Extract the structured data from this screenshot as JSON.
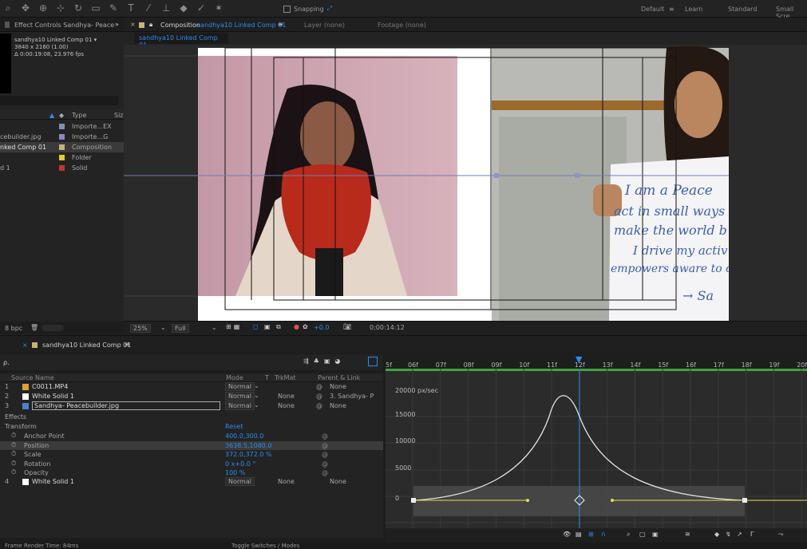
{
  "toolbar": {
    "snapping_label": "Snapping",
    "workspaces": [
      "Default",
      "Learn",
      "Standard",
      "Small Scre"
    ],
    "workspace_menu_icon": "menu-lines-icon"
  },
  "left_panel": {
    "tab_title": "Effect Controls Sandhya- Peace",
    "tab_overflow": "»",
    "item_name": "sandhya10 Linked Comp 01 ▾",
    "item_size": "3840 x 2160 (1.00)",
    "item_duration": "Δ 0:00:19:08, 23.976 fps",
    "search_placeholder": "",
    "col_type": "Type",
    "col_size": "Size",
    "items": [
      {
        "name": "",
        "type": "Importe...EX",
        "swatch": "#7f8fb5"
      },
      {
        "name": "cebuilder.jpg",
        "type": "Importe...G",
        "swatch": "#8a86c8"
      },
      {
        "name": "nked Comp 01",
        "type": "Composition",
        "swatch": "#c8b478",
        "selected": true
      },
      {
        "name": "",
        "type": "Folder",
        "swatch": "#e6cc2a"
      },
      {
        "name": "d 1",
        "type": "Solid",
        "swatch": "#d12f2f"
      }
    ],
    "bpc": "8 bpc"
  },
  "composition": {
    "close_icon": "×",
    "tab_label": "Composition",
    "tab_name": "sandhya10 Linked Comp 01",
    "tab_menu": "≡",
    "layer_label": "Layer (none)",
    "footage_label": "Footage (none)",
    "subtab": "sandhya10 Linked Comp 01",
    "handwritten_lines": [
      "I am a Peace",
      "act in small ways",
      "make the world b",
      "I drive my activ",
      "empowers aware to c",
      "→ Sa"
    ]
  },
  "viewer_bar": {
    "zoom": "25%",
    "resolution": "Full",
    "exposure": "+0.0",
    "timecode": "0;00:14:12"
  },
  "timeline": {
    "tab_name": "sandhya10 Linked Comp 01",
    "tab_menu": "≡",
    "search_icon": "ρ.",
    "columns": {
      "source": "Source Name",
      "mode": "Mode",
      "t": "T",
      "trkmat": "TrkMat",
      "parent": "Parent & Link"
    },
    "layers": [
      {
        "num": "1",
        "name": "C0011.MP4",
        "color": "#e0a030",
        "mode": "Normal",
        "trkmat": "",
        "parent": "None"
      },
      {
        "num": "2",
        "name": "White Solid 1",
        "color": "#ffffff",
        "mode": "Normal",
        "trkmat": "None",
        "parent": "3. Sandhya- P"
      },
      {
        "num": "3",
        "name": "Sandhya- Peacebuilder.jpg",
        "color": "#4d7fcc",
        "mode": "Normal",
        "trkmat": "None",
        "parent": "None",
        "selected": true
      }
    ],
    "effects_label": "Effects",
    "transform_label": "Transform",
    "reset_label": "Reset",
    "properties": [
      {
        "name": "Anchor Point",
        "value": "400.0,300.0"
      },
      {
        "name": "Position",
        "value": "3638.5,1080.0",
        "selected": true
      },
      {
        "name": "Scale",
        "value": "372.0,372.0 %",
        "link": "∞"
      },
      {
        "name": "Rotation",
        "value": "0 x+0.0 °"
      },
      {
        "name": "Opacity",
        "value": "100 %"
      }
    ],
    "layer4": {
      "num": "4",
      "name": "White Solid 1",
      "mode": "Normal",
      "trkmat": "None",
      "parent": "None"
    },
    "toggle_label": "Toggle Switches / Modes",
    "render_time": "Frame Render Time: 84ms"
  },
  "ruler": {
    "ticks": [
      "5f",
      "06f",
      "07f",
      "08f",
      "09f",
      "10f",
      "11f",
      "12f",
      "13f",
      "14f",
      "15f",
      "16f",
      "17f",
      "18f",
      "19f",
      "20f"
    ]
  },
  "graph": {
    "y_unit_label": "20000 px/sec",
    "y_labels": [
      "15000",
      "10000",
      "5000",
      "0"
    ],
    "curve_color": "#e4e4e4",
    "keyframe_color": "#e8e04a"
  }
}
